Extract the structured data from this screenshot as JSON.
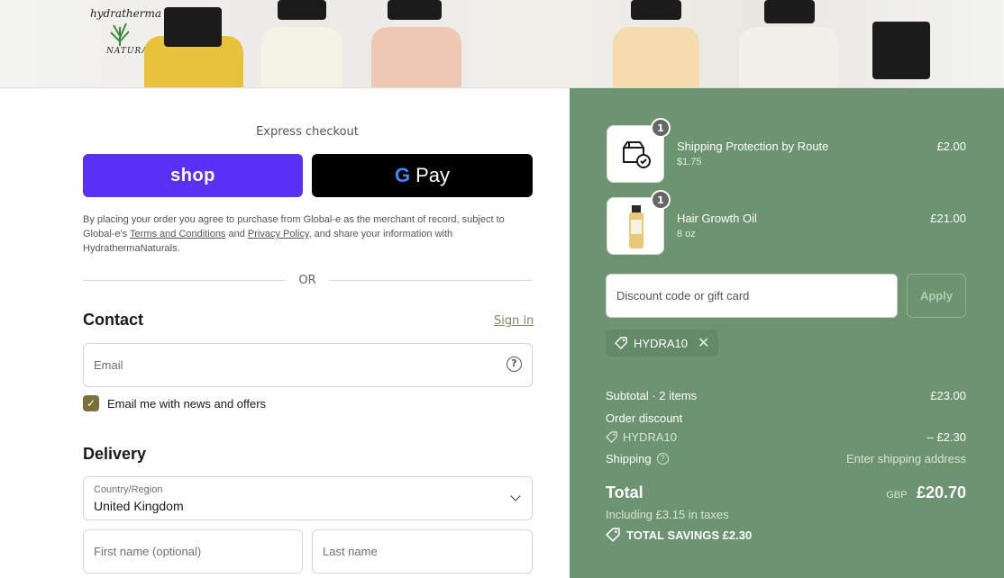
{
  "brand": {
    "logo_line1": "hydratherma",
    "logo_line2": "NATURALS"
  },
  "express": {
    "label": "Express checkout",
    "shop_label": "shop",
    "gpay_label": "Pay"
  },
  "legal": {
    "text1": "By placing your order you agree to purchase from Global-e as the merchant of record, subject to Global-e's ",
    "terms_link": "Terms and Conditions",
    "text2": " and ",
    "privacy_link": "Privacy Policy",
    "text3": ", and share your information with HydrathermaNaturals."
  },
  "or_label": "OR",
  "contact": {
    "title": "Contact",
    "signin": "Sign in",
    "email_placeholder": "Email",
    "newsletter_label": "Email me with news and offers",
    "newsletter_checked": true
  },
  "delivery": {
    "title": "Delivery",
    "country_label": "Country/Region",
    "country_value": "United Kingdom",
    "first_name_placeholder": "First name (optional)",
    "last_name_placeholder": "Last name"
  },
  "cart": {
    "items": [
      {
        "name": "Shipping Protection by Route",
        "variant": "$1.75",
        "price": "£2.00",
        "qty": "1",
        "icon": "package-check-icon"
      },
      {
        "name": "Hair Growth Oil",
        "variant": "8 oz",
        "price": "£21.00",
        "qty": "1",
        "icon": "oil-bottle-image"
      }
    ],
    "discount_placeholder": "Discount code or gift card",
    "apply_label": "Apply",
    "applied_code": "HYDRA10",
    "subtotal_label": "Subtotal · 2 items",
    "subtotal_value": "£23.00",
    "order_discount_label": "Order discount",
    "discount_code": "HYDRA10",
    "discount_value": "– £2.30",
    "shipping_label": "Shipping",
    "shipping_value": "Enter shipping address",
    "total_label": "Total",
    "currency": "GBP",
    "total_value": "£20.70",
    "taxes_note": "Including £3.15 in taxes",
    "savings_label": "TOTAL SAVINGS £2.30"
  },
  "colors": {
    "shop_pay": "#5a31f4",
    "summary_bg": "#6c9470",
    "accent": "#758b5c"
  }
}
